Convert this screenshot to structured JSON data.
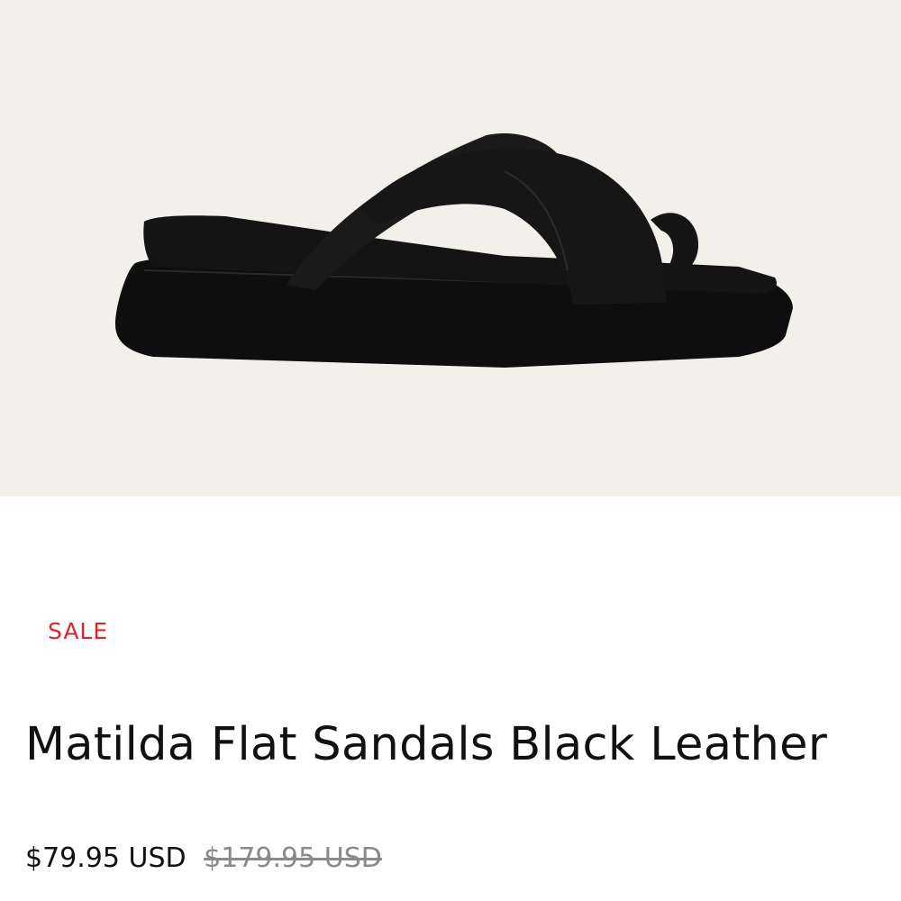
{
  "product": {
    "image_alt": "Matilda Flat Sandals Black Leather",
    "sale_label": "SALE",
    "title": "Matilda Flat Sandals Black Leather",
    "price_current": "$79.95 USD",
    "price_original": "$179.95 USD"
  },
  "colors": {
    "image_background": "#f3f0eb",
    "sale": "#d8262b",
    "text": "#111111",
    "muted": "#8a8a8a"
  }
}
